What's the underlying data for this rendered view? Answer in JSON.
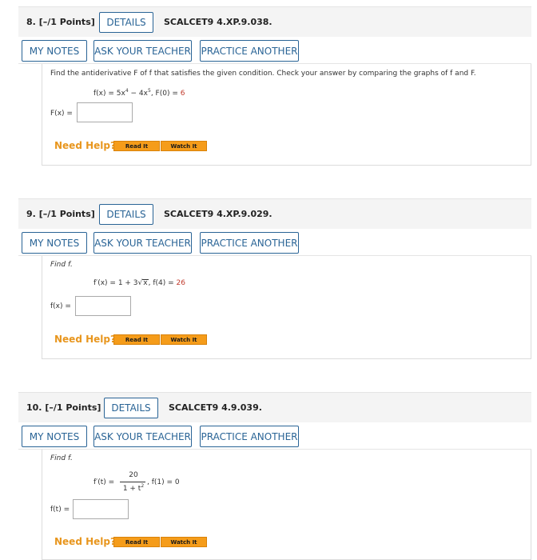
{
  "common": {
    "details_label": "DETAILS",
    "my_notes_label": "MY NOTES",
    "ask_teacher_label": "ASK YOUR TEACHER",
    "practice_label": "PRACTICE ANOTHER",
    "need_help_label": "Need Help?",
    "read_it_label": "Read It",
    "watch_it_label": "Watch It"
  },
  "questions": [
    {
      "number": "8.",
      "points": "[–/1 Points]",
      "code": "SCALCET9 4.XP.9.038.",
      "instruction": "Find the antiderivative F of f that satisfies the given condition. Check your answer by comparing the graphs of f and F.",
      "eq_lhs": "f(x) = 5x",
      "eq_exp1": "4",
      "eq_mid": " − 4x",
      "eq_exp2": "5",
      "eq_cond_lhs": ",   F(0) = ",
      "eq_cond_val": "6",
      "answer_label": "F(x) ="
    },
    {
      "number": "9.",
      "points": "[–/1 Points]",
      "code": "SCALCET9 4.XP.9.029.",
      "instruction": "Find f.",
      "eq_lhs": "f′(x) = 1 + 3",
      "eq_radicand": "x",
      "eq_cond_lhs": ",   f(4) = ",
      "eq_cond_val": "26",
      "answer_label": "f(x) ="
    },
    {
      "number": "10.",
      "points": "[–/1 Points]",
      "code": "SCALCET9 4.9.039.",
      "instruction": "Find f.",
      "eq_lhs": "f′(t) =",
      "eq_num": "20",
      "eq_den": "1 + t",
      "eq_den_exp": "2",
      "eq_cond": ",   f(1) = 0",
      "answer_label": "f(t) ="
    }
  ]
}
